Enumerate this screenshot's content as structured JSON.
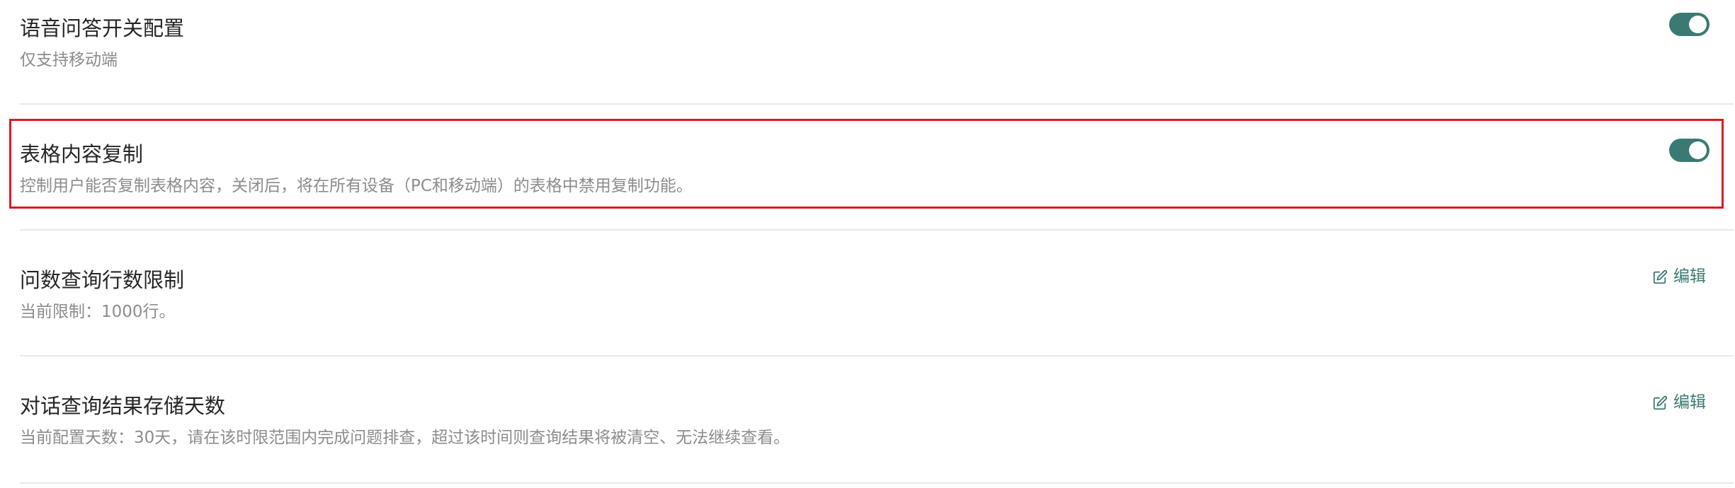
{
  "settings": [
    {
      "title": "语音问答开关配置",
      "description": "仅支持移动端",
      "control": "toggle",
      "enabled": true
    },
    {
      "title": "表格内容复制",
      "description": "控制用户能否复制表格内容，关闭后，将在所有设备（PC和移动端）的表格中禁用复制功能。",
      "control": "toggle",
      "enabled": true,
      "highlighted": true
    },
    {
      "title": "问数查询行数限制",
      "description": "当前限制：1000行。",
      "control": "edit",
      "action_label": "编辑",
      "action_icon": "edit-icon"
    },
    {
      "title": "对话查询结果存储天数",
      "description": "当前配置天数：30天，请在该时限范围内完成问题排查，超过该时间则查询结果将被清空、无法继续查看。",
      "control": "edit",
      "action_label": "编辑",
      "action_icon": "edit-icon"
    }
  ],
  "colors": {
    "accent": "#3a7a73",
    "highlight_border": "#e0171f",
    "title_text": "#262626",
    "desc_text": "#8c8c8c",
    "divider": "#e8e8e8"
  }
}
